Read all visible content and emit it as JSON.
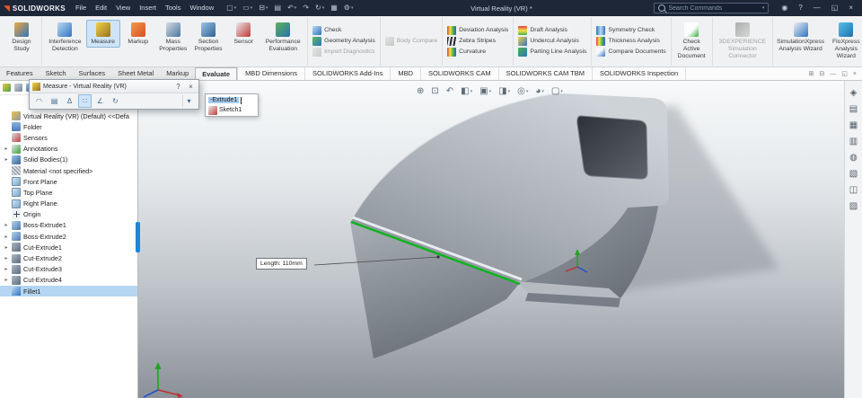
{
  "titlebar": {
    "app_name": "SOLIDWORKS",
    "logo_glyph": "◥",
    "menus": [
      "File",
      "Edit",
      "View",
      "Insert",
      "Tools",
      "Window"
    ],
    "quick_access": [
      {
        "name": "new-document",
        "glyph": "▢",
        "caret": true
      },
      {
        "name": "open-document",
        "glyph": "▭",
        "caret": true
      },
      {
        "name": "save-document",
        "glyph": "⊟",
        "caret": true
      },
      {
        "name": "print",
        "glyph": "▤",
        "caret": false
      },
      {
        "name": "undo",
        "glyph": "↶",
        "caret": true
      },
      {
        "name": "redo",
        "glyph": "↷",
        "caret": false
      },
      {
        "name": "rebuild",
        "glyph": "↻",
        "caret": true
      },
      {
        "name": "file-properties",
        "glyph": "▦",
        "caret": false
      },
      {
        "name": "options",
        "glyph": "⚙",
        "caret": true
      }
    ],
    "document_title": "Virtual Reality (VR) *",
    "search": {
      "placeholder": "Search Commands"
    },
    "right_icons": [
      {
        "name": "user-account",
        "glyph": "◉"
      },
      {
        "name": "help",
        "glyph": "?"
      },
      {
        "name": "minimize",
        "glyph": "—"
      },
      {
        "name": "restore",
        "glyph": "◱"
      },
      {
        "name": "close",
        "glyph": "×"
      }
    ]
  },
  "ribbon": {
    "groups": [
      {
        "type": "tall",
        "items": [
          {
            "label": "Design Study",
            "icon": "design-study"
          }
        ]
      },
      {
        "type": "tall",
        "items": [
          {
            "label": "Interference Detection",
            "icon": "interference-detection"
          },
          {
            "label": "Measure",
            "icon": "measure",
            "active": true
          },
          {
            "label": "Markup",
            "icon": "markup"
          },
          {
            "label": "Mass Properties",
            "icon": "mass-properties"
          },
          {
            "label": "Section Properties",
            "icon": "section-properties"
          },
          {
            "label": "Sensor",
            "icon": "sensor"
          },
          {
            "label": "Performance Evaluation",
            "icon": "performance-evaluation"
          }
        ]
      },
      {
        "type": "stack",
        "items": [
          {
            "label": "Check",
            "icon": "check"
          },
          {
            "label": "Geometry Analysis",
            "icon": "geometry-analysis"
          },
          {
            "label": "Import Diagnostics",
            "icon": "import-diagnostics",
            "disabled": true
          }
        ]
      },
      {
        "type": "stack",
        "items": [
          {
            "label": "Body Compare",
            "icon": "body-compare",
            "disabled": true
          }
        ]
      },
      {
        "type": "stack",
        "items": [
          {
            "label": "Deviation Analysis",
            "icon": "deviation-analysis"
          },
          {
            "label": "Zebra Stripes",
            "icon": "zebra-stripes"
          },
          {
            "label": "Curvature",
            "icon": "curvature"
          }
        ]
      },
      {
        "type": "stack",
        "items": [
          {
            "label": "Draft Analysis",
            "icon": "draft-analysis"
          },
          {
            "label": "Undercut Analysis",
            "icon": "undercut-analysis"
          },
          {
            "label": "Parting Line Analysis",
            "icon": "parting-line-analysis"
          }
        ]
      },
      {
        "type": "stack",
        "items": [
          {
            "label": "Symmetry Check",
            "icon": "symmetry-check"
          },
          {
            "label": "Thickness Analysis",
            "icon": "thickness-analysis"
          },
          {
            "label": "Compare Documents",
            "icon": "compare-documents"
          }
        ]
      },
      {
        "type": "tall",
        "items": [
          {
            "label": "Check Active Document",
            "icon": "check-active-document"
          }
        ]
      },
      {
        "type": "tall",
        "items": [
          {
            "label": "3DEXPERIENCE Simulation Connector",
            "icon": "threedexperience",
            "disabled": true
          }
        ]
      },
      {
        "type": "tall",
        "items": [
          {
            "label": "SimulationXpress Analysis Wizard",
            "icon": "simulationxpress"
          },
          {
            "label": "FloXpress Analysis Wizard",
            "icon": "floxpress"
          }
        ]
      }
    ]
  },
  "tabs": {
    "left": [
      {
        "label": "Features"
      },
      {
        "label": "Sketch"
      },
      {
        "label": "Surfaces"
      },
      {
        "label": "Sheet Metal"
      },
      {
        "label": "Markup"
      },
      {
        "label": "Evaluate",
        "active": true
      }
    ],
    "right": [
      "MBD Dimensions",
      "SOLIDWORKS Add-Ins",
      "MBD",
      "SOLIDWORKS CAM",
      "SOLIDWORKS CAM TBM",
      "SOLIDWORKS Inspection"
    ],
    "window_icons": [
      {
        "name": "pane-split",
        "glyph": "⊞"
      },
      {
        "name": "pane-toggle",
        "glyph": "⊟"
      },
      {
        "name": "doc-minimize",
        "glyph": "—"
      },
      {
        "name": "doc-restore",
        "glyph": "◱"
      },
      {
        "name": "doc-close",
        "glyph": "×"
      }
    ]
  },
  "panel_toolbar_icons": [
    {
      "name": "featuremanager-design-tree",
      "icon": "ptree"
    },
    {
      "name": "property-manager",
      "icon": "pconfig"
    },
    {
      "name": "display-manager",
      "icon": "pdisplay"
    }
  ],
  "feature_tree": {
    "items": [
      {
        "label": "Virtual Reality (VR) (Default) <<Defa",
        "icon": "part"
      },
      {
        "label": "Folder",
        "icon": "folder"
      },
      {
        "label": "Sensors",
        "icon": "sensors"
      },
      {
        "label": "Annotations",
        "icon": "annotations",
        "caret": true
      },
      {
        "label": "Solid Bodies(1)",
        "icon": "solid-bodies",
        "caret": true
      },
      {
        "label": "Material <not specified>",
        "icon": "material"
      },
      {
        "label": "Front Plane",
        "icon": "plane"
      },
      {
        "label": "Top Plane",
        "icon": "plane"
      },
      {
        "label": "Right Plane",
        "icon": "plane"
      },
      {
        "label": "Origin",
        "icon": "origin"
      },
      {
        "label": "Boss-Extrude1",
        "icon": "boss-extrude",
        "caret": true
      },
      {
        "label": "Boss-Extrude2",
        "icon": "boss-extrude",
        "caret": true
      },
      {
        "label": "Cut-Extrude1",
        "icon": "cut-extrude",
        "caret": true
      },
      {
        "label": "Cut-Extrude2",
        "icon": "cut-extrude",
        "caret": true
      },
      {
        "label": "Cut-Extrude3",
        "icon": "cut-extrude",
        "caret": true
      },
      {
        "label": "Cut-Extrude4",
        "icon": "cut-extrude",
        "caret": true
      },
      {
        "label": "Fillet1",
        "icon": "fillet",
        "selected": true
      }
    ]
  },
  "measure_dialog": {
    "title": "Measure - Virtual Reality (VR)",
    "help_label": "?",
    "close_label": "×",
    "tools": [
      {
        "name": "circle-arc-measure",
        "glyph": "◠"
      },
      {
        "name": "units-precision",
        "glyph": "▤"
      },
      {
        "name": "show-xyz",
        "glyph": "Δ"
      },
      {
        "name": "point-to-point",
        "glyph": "∷",
        "active": true
      },
      {
        "name": "projected-on",
        "glyph": "∠"
      },
      {
        "name": "measurement-history",
        "glyph": "↻"
      },
      {
        "name": "measure-dropdown",
        "glyph": "▾",
        "dd": true
      }
    ]
  },
  "selection_flyout": {
    "items": [
      {
        "label": "-Extrude1",
        "selected": true
      },
      {
        "label": "Sketch1",
        "icon": "sketch"
      }
    ]
  },
  "viewport": {
    "callout_text": "Length: 110mm",
    "edge_color": "#0db41c",
    "hud_icons": [
      {
        "name": "zoom-fit",
        "glyph": "⊕"
      },
      {
        "name": "zoom-area",
        "glyph": "⊡"
      },
      {
        "name": "previous-view",
        "glyph": "↶"
      },
      {
        "name": "section-view",
        "glyph": "◧",
        "caret": true
      },
      {
        "name": "view-orientation",
        "glyph": "▣",
        "caret": true
      },
      {
        "name": "display-style",
        "glyph": "◨",
        "caret": true
      },
      {
        "name": "hide-show-items",
        "glyph": "◎",
        "caret": true
      },
      {
        "name": "edit-appearance",
        "glyph": "◕",
        "caret": true
      },
      {
        "name": "view-settings",
        "glyph": "▢",
        "caret": true
      }
    ]
  },
  "task_pane_icons": [
    {
      "name": "3dexperience-home",
      "glyph": "◈"
    },
    {
      "name": "design-library",
      "glyph": "▤"
    },
    {
      "name": "file-explorer",
      "glyph": "▦"
    },
    {
      "name": "view-palette",
      "glyph": "▥"
    },
    {
      "name": "appearances-scenes",
      "glyph": "◍"
    },
    {
      "name": "custom-properties",
      "glyph": "▧"
    },
    {
      "name": "forum",
      "glyph": "◫"
    },
    {
      "name": "tags",
      "glyph": "▨"
    }
  ],
  "colors": {
    "selection_highlight": "#b5d6f2",
    "active_button": "#cfe4f7",
    "titlebar_background": "#1d2738",
    "selected_edge_green": "#0db41c"
  }
}
